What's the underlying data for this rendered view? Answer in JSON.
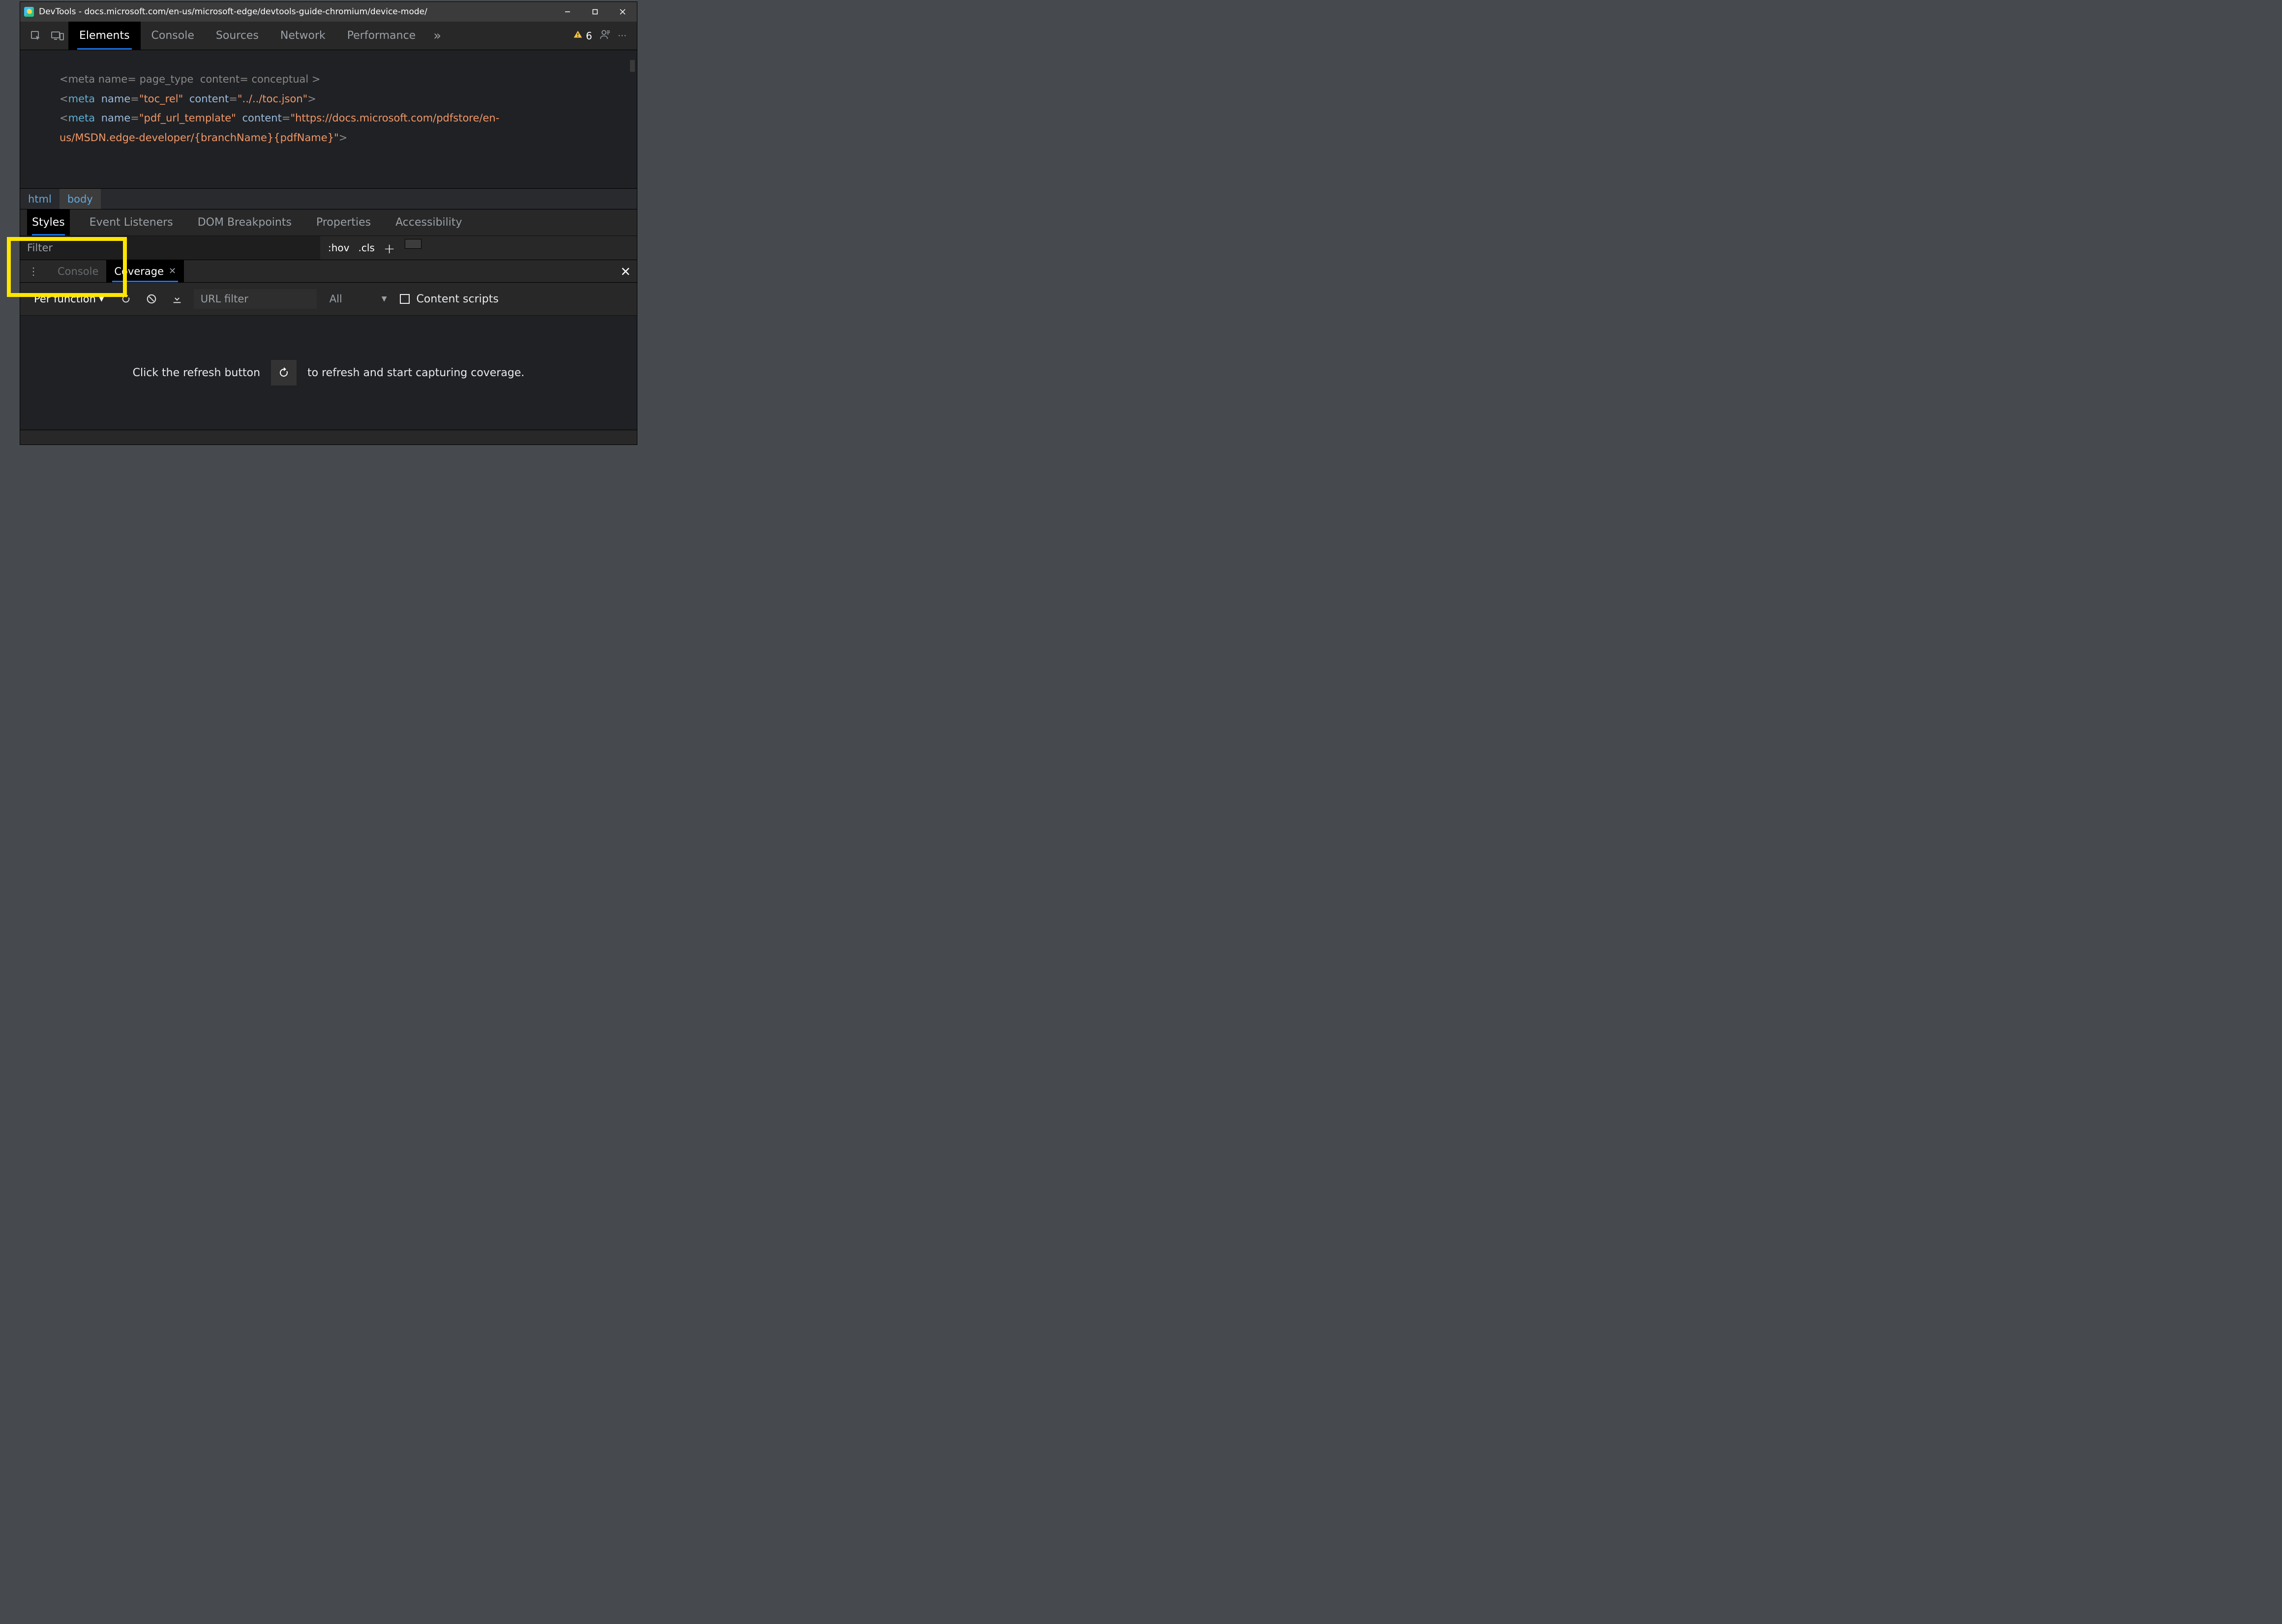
{
  "window": {
    "title": "DevTools - docs.microsoft.com/en-us/microsoft-edge/devtools-guide-chromium/device-mode/"
  },
  "main_tabs": {
    "elements": "Elements",
    "console": "Console",
    "sources": "Sources",
    "network": "Network",
    "performance": "Performance",
    "overflow_glyph": "»",
    "warning_count": "6"
  },
  "code": {
    "line0_raw": "<meta name=\"page_type\" content=\"conceptual\">",
    "line1_raw": "<meta name=\"toc_rel\" content=\"../../toc.json\">",
    "line2_raw": "<meta name=\"pdf_url_template\" content=\"https://docs.microsoft.com/pdfstore/en-us/MSDN.edge-developer/{branchName}{pdfName}\">",
    "attr1": "name",
    "val1a": "\"page_type\"",
    "attr2": "content",
    "val1b": "\"conceptual\"",
    "val2a": "\"toc_rel\"",
    "val2b": "\"../../toc.json\"",
    "val3a": "\"pdf_url_template\"",
    "val3b_part1": "\"https://docs.microsoft.com/pdfstore/en-",
    "val3b_part2": "us/MSDN.edge-developer/{branchName}{pdfName}\"",
    "tag": "meta"
  },
  "breadcrumb": {
    "html": "html",
    "body": "body"
  },
  "sub_tabs": {
    "styles": "Styles",
    "events": "Event Listeners",
    "dom": "DOM Breakpoints",
    "props": "Properties",
    "a11y": "Accessibility"
  },
  "styles_bar": {
    "filter_placeholder": "Filter",
    "hov": ":hov",
    "cls": ".cls",
    "plus": "+"
  },
  "drawer": {
    "console_tab": "Console",
    "coverage_tab": "Coverage"
  },
  "coverage": {
    "mode_label": "Per function",
    "url_filter_placeholder": "URL filter",
    "type_select": "All",
    "content_scripts_label": "Content scripts",
    "empty_msg_before": "Click the refresh button",
    "empty_msg_after": "to refresh and start capturing coverage."
  }
}
